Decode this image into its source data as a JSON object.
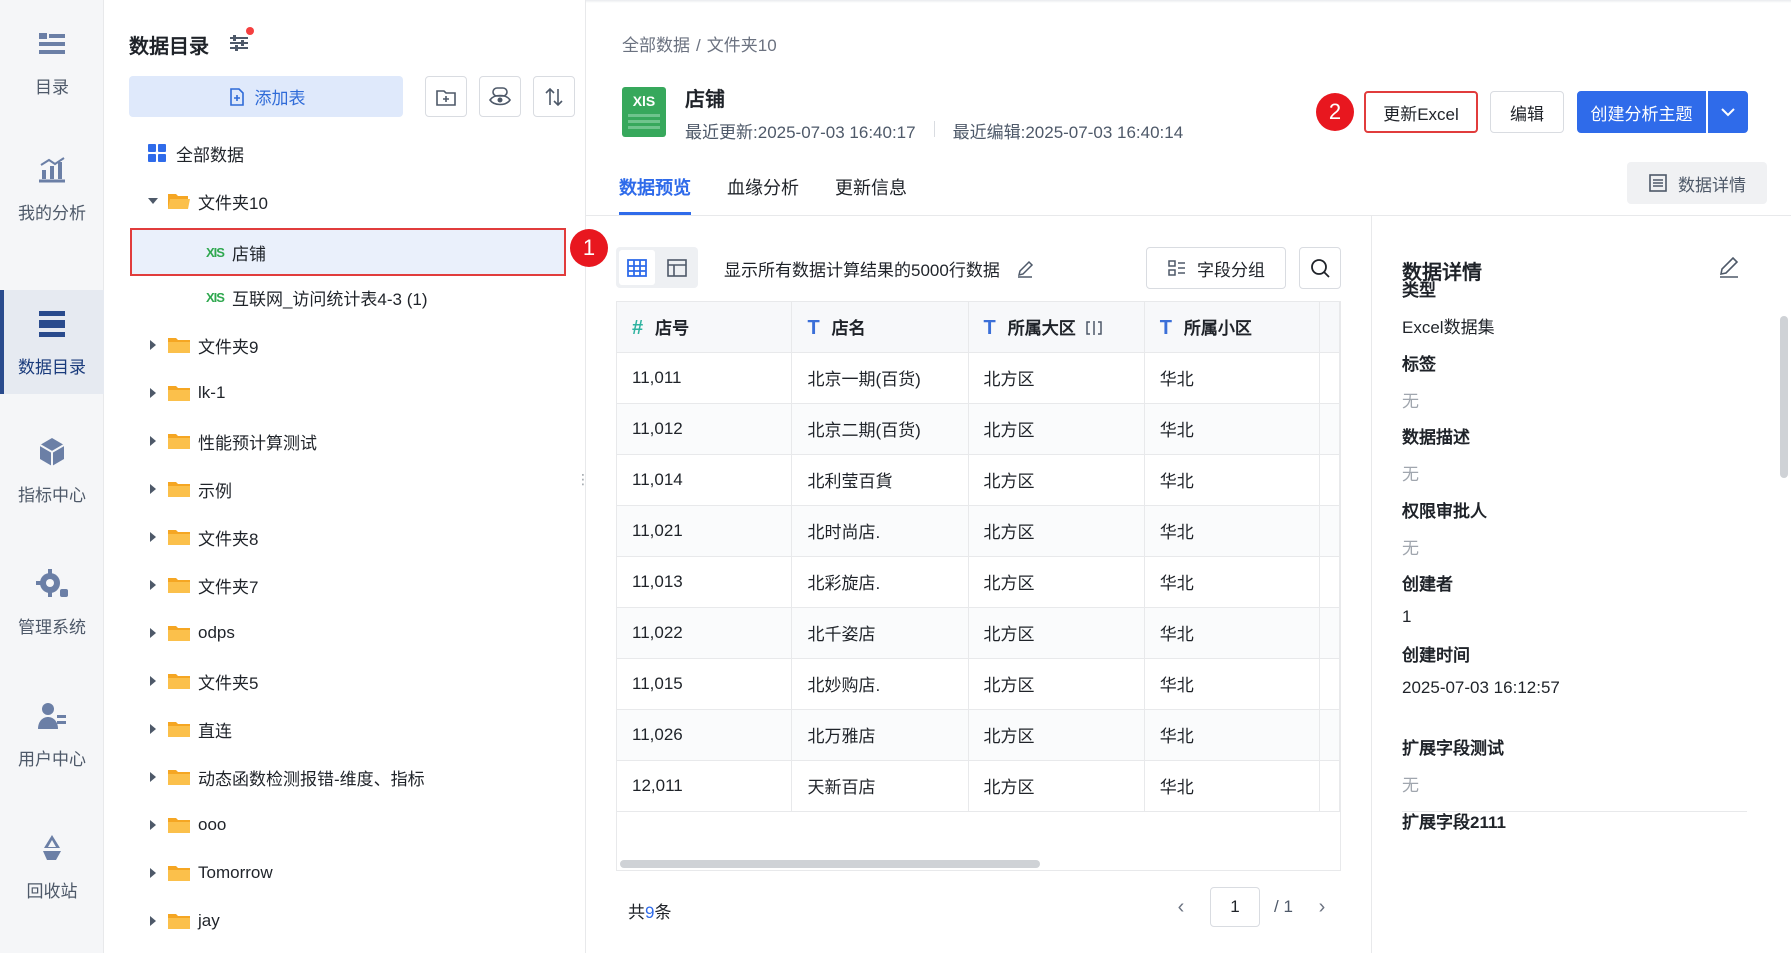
{
  "rail": {
    "items": [
      {
        "label": "目录",
        "icon": "list-icon"
      },
      {
        "label": "我的分析",
        "icon": "chart-icon"
      },
      {
        "label": "数据目录",
        "icon": "catalog-icon",
        "active": true
      },
      {
        "label": "指标中心",
        "icon": "cube-icon"
      },
      {
        "label": "管理系统",
        "icon": "gear-icon"
      },
      {
        "label": "用户中心",
        "icon": "user-icon"
      },
      {
        "label": "回收站",
        "icon": "recycle-icon"
      }
    ]
  },
  "tree": {
    "title": "数据目录",
    "add_label": "添加表",
    "nodes": [
      {
        "label": "全部数据",
        "type": "root"
      },
      {
        "label": "文件夹10",
        "type": "folder-open"
      },
      {
        "label": "店铺",
        "type": "xls",
        "selected": true,
        "xls_tag": "XIS"
      },
      {
        "label": "互联网_访问统计表4-3 (1)",
        "type": "xls",
        "xls_tag": "XIS"
      },
      {
        "label": "文件夹9",
        "type": "folder"
      },
      {
        "label": "lk-1",
        "type": "folder"
      },
      {
        "label": "性能预计算测试",
        "type": "folder"
      },
      {
        "label": "示例",
        "type": "folder"
      },
      {
        "label": "文件夹8",
        "type": "folder"
      },
      {
        "label": "文件夹7",
        "type": "folder"
      },
      {
        "label": "odps",
        "type": "folder"
      },
      {
        "label": "文件夹5",
        "type": "folder"
      },
      {
        "label": "直连",
        "type": "folder"
      },
      {
        "label": "动态函数检测报错-维度、指标",
        "type": "folder"
      },
      {
        "label": "ooo",
        "type": "folder"
      },
      {
        "label": "Tomorrow",
        "type": "folder"
      },
      {
        "label": "jay",
        "type": "folder"
      }
    ]
  },
  "badges": {
    "one": "1",
    "two": "2"
  },
  "main": {
    "breadcrumb": {
      "root": "全部数据",
      "sep": "/",
      "current": "文件夹10"
    },
    "dataset": {
      "title": "店铺",
      "icon_tag": "XlS",
      "last_update_label": "最近更新:",
      "last_update": "2025-07-03 16:40:17",
      "last_edit_label": "最近编辑:",
      "last_edit": "2025-07-03 16:40:14"
    },
    "buttons": {
      "update_excel": "更新Excel",
      "edit": "编辑",
      "create_topic": "创建分析主题",
      "data_detail": "数据详情",
      "field_group": "字段分组"
    },
    "tabs": [
      "数据预览",
      "血缘分析",
      "更新信息"
    ],
    "info_text": "显示所有数据计算结果的5000行数据",
    "table": {
      "columns": [
        {
          "label": "店号",
          "type": "#"
        },
        {
          "label": "店名",
          "type": "T"
        },
        {
          "label": "所属大区",
          "type": "T"
        },
        {
          "label": "所属小区",
          "type": "T"
        }
      ],
      "rows": [
        [
          "11,011",
          "北京一期(百货)",
          "北方区",
          "华北"
        ],
        [
          "11,012",
          "北京二期(百货)",
          "北方区",
          "华北"
        ],
        [
          "11,014",
          "北利莹百貨",
          "北方区",
          "华北"
        ],
        [
          "11,021",
          "北时尚店.",
          "北方区",
          "华北"
        ],
        [
          "11,013",
          "北彩旋店.",
          "北方区",
          "华北"
        ],
        [
          "11,022",
          "北千姿店",
          "北方区",
          "华北"
        ],
        [
          "11,015",
          "北妙购店.",
          "北方区",
          "华北"
        ],
        [
          "11,026",
          "北万雅店",
          "北方区",
          "华北"
        ],
        [
          "12,011",
          "天新百店",
          "北方区",
          "华北"
        ]
      ]
    },
    "footer": {
      "prefix": "共",
      "count": "9",
      "suffix": "条",
      "page": "1",
      "of": "/ 1"
    }
  },
  "side": {
    "title": "数据详情",
    "fields": [
      {
        "key": "类型",
        "value": "Excel数据集",
        "muted": false
      },
      {
        "key": "标签",
        "value": "无",
        "muted": true
      },
      {
        "key": "数据描述",
        "value": "无",
        "muted": true
      },
      {
        "key": "权限审批人",
        "value": "无",
        "muted": true
      },
      {
        "key": "创建者",
        "value": "1",
        "muted": false
      },
      {
        "key": "创建时间",
        "value": "2025-07-03 16:12:57",
        "muted": false
      },
      {
        "key": "扩展字段测试",
        "value": "无",
        "muted": true
      },
      {
        "key": "扩展字段2111",
        "value": "",
        "muted": false
      }
    ]
  },
  "colors": {
    "accent": "#2f6bea",
    "highlight_border": "#e13c3c",
    "badge": "#e8171f",
    "excel_green": "#37a85c"
  }
}
